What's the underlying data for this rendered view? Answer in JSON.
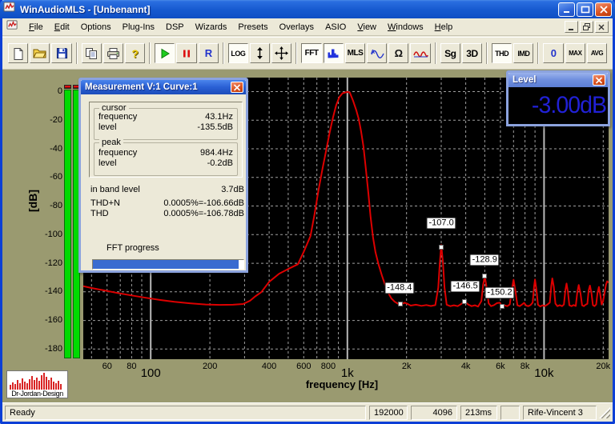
{
  "window": {
    "title": "WinAudioMLS - [Unbenannt]"
  },
  "menu": {
    "items": [
      {
        "label": "File",
        "u": 0
      },
      {
        "label": "Edit",
        "u": 0
      },
      {
        "label": "Options",
        "u": -1
      },
      {
        "label": "Plug-Ins",
        "u": -1
      },
      {
        "label": "DSP",
        "u": -1
      },
      {
        "label": "Wizards",
        "u": -1
      },
      {
        "label": "Presets",
        "u": -1
      },
      {
        "label": "Overlays",
        "u": -1
      },
      {
        "label": "ASIO",
        "u": -1
      },
      {
        "label": "View",
        "u": 0
      },
      {
        "label": "Windows",
        "u": 0
      },
      {
        "label": "Help",
        "u": 0
      }
    ]
  },
  "toolbar": {
    "groups": [
      [
        {
          "name": "new-document",
          "icon": "new-document"
        },
        {
          "name": "open-file",
          "icon": "open-folder"
        },
        {
          "name": "save-file",
          "icon": "save-floppy"
        }
      ],
      [
        {
          "name": "copy",
          "icon": "copy-pages"
        },
        {
          "name": "print",
          "icon": "printer"
        },
        {
          "name": "help",
          "icon": "help-question"
        }
      ],
      [
        {
          "name": "play",
          "icon": "play-triangle",
          "pressed": true
        },
        {
          "name": "pause",
          "icon": "pause-bars"
        },
        {
          "name": "record",
          "label": "R",
          "color": "#2233cc",
          "size": 13
        }
      ],
      [
        {
          "name": "log-scale",
          "label": "LOG",
          "pressed": true,
          "size": 9
        },
        {
          "name": "vertical-scale",
          "icon": "v-arrow"
        },
        {
          "name": "pan",
          "icon": "move-cross"
        }
      ],
      [
        {
          "name": "fft-mode",
          "label": "FFT",
          "pressed": true,
          "size": 10
        },
        {
          "name": "spectrum-display",
          "icon": "spectrum-bars",
          "pressed": true
        },
        {
          "name": "mls-mode",
          "label": "MLS",
          "size": 10
        },
        {
          "name": "sine-signal",
          "icon": "sine-wave"
        },
        {
          "name": "impedance",
          "icon": "omega"
        },
        {
          "name": "overlay-curves",
          "icon": "red-wave"
        }
      ],
      [
        {
          "name": "signal-generator",
          "label": "Sg",
          "size": 12
        },
        {
          "name": "3d-view",
          "label": "3D",
          "size": 12
        }
      ],
      [
        {
          "name": "thd-mode",
          "label": "THD",
          "pressed": true,
          "size": 9
        },
        {
          "name": "imd-mode",
          "label": "IMD",
          "size": 9
        }
      ],
      [
        {
          "name": "reset",
          "label": "0",
          "color": "#2233cc",
          "size": 13
        },
        {
          "name": "max-hold",
          "label": "MAX",
          "size": 8
        },
        {
          "name": "average",
          "label": "AVG",
          "size": 8
        }
      ]
    ]
  },
  "chart_data": {
    "type": "line",
    "xlabel": "frequency [Hz]",
    "ylabel": "[dB]",
    "x_scale": "log",
    "xlim": [
      45.4,
      21300
    ],
    "ylim": [
      -180,
      0
    ],
    "grid": "on",
    "y_ticks": [
      "0",
      "-20",
      "-40",
      "-60",
      "-80",
      "-100",
      "-120",
      "-140",
      "-160",
      "-180"
    ],
    "y_tick_values": [
      0,
      -20,
      -40,
      -60,
      -80,
      -100,
      -120,
      -140,
      -160,
      -180
    ],
    "x_ticks_minor": [
      {
        "f": 60,
        "t": "60"
      },
      {
        "f": 80,
        "t": "80"
      },
      {
        "f": 200,
        "t": "200"
      },
      {
        "f": 400,
        "t": "400"
      },
      {
        "f": 600,
        "t": "600"
      },
      {
        "f": 800,
        "t": "800"
      },
      {
        "f": 2000,
        "t": "2k"
      },
      {
        "f": 4000,
        "t": "4k"
      },
      {
        "f": 6000,
        "t": "6k"
      },
      {
        "f": 8000,
        "t": "8k"
      },
      {
        "f": 20000,
        "t": "20k"
      }
    ],
    "x_ticks_major": [
      {
        "f": 100,
        "t": "100"
      },
      {
        "f": 1000,
        "t": "1k"
      },
      {
        "f": 10000,
        "t": "10k"
      }
    ],
    "series": [
      {
        "name": "spectrum",
        "color": "#dd0000",
        "points": [
          [
            45.4,
            -136
          ],
          [
            50,
            -137.3
          ],
          [
            58,
            -139
          ],
          [
            68,
            -140.8
          ],
          [
            80,
            -142.5
          ],
          [
            95,
            -144.2
          ],
          [
            112,
            -145.7
          ],
          [
            132,
            -147
          ],
          [
            158,
            -148
          ],
          [
            190,
            -148.8
          ],
          [
            225,
            -149.1
          ],
          [
            262,
            -149
          ],
          [
            295,
            -148.5
          ],
          [
            320,
            -146.2
          ],
          [
            340,
            -143.2
          ],
          [
            365,
            -140.2
          ],
          [
            400,
            -133
          ],
          [
            450,
            -127.3
          ],
          [
            500,
            -124
          ],
          [
            560,
            -120.7
          ],
          [
            600,
            -112
          ],
          [
            649,
            -101
          ],
          [
            680,
            -86
          ],
          [
            713,
            -69
          ],
          [
            747,
            -54
          ],
          [
            783,
            -40
          ],
          [
            813,
            -28.5
          ],
          [
            844,
            -18.4
          ],
          [
            877,
            -9.5
          ],
          [
            910,
            -3.9
          ],
          [
            945,
            -1.1
          ],
          [
            1000,
            -0.2
          ],
          [
            1029,
            -0.6
          ],
          [
            1068,
            -6.2
          ],
          [
            1109,
            -12.8
          ],
          [
            1141,
            -19
          ],
          [
            1173,
            -27.4
          ],
          [
            1207,
            -38.5
          ],
          [
            1241,
            -53.6
          ],
          [
            1277,
            -70.4
          ],
          [
            1313,
            -87.7
          ],
          [
            1351,
            -102.2
          ],
          [
            1390,
            -112.3
          ],
          [
            1443,
            -121.2
          ],
          [
            1498,
            -128.5
          ],
          [
            1555,
            -135.2
          ],
          [
            1615,
            -140.8
          ],
          [
            1677,
            -144.7
          ],
          [
            1741,
            -146.9
          ],
          [
            1825,
            -148.6
          ],
          [
            1900,
            -148.4
          ],
          [
            1955,
            -147.6
          ],
          [
            2020,
            -148.3
          ],
          [
            2100,
            -149.6
          ],
          [
            2230,
            -149
          ],
          [
            2380,
            -149.8
          ],
          [
            2520,
            -149.2
          ],
          [
            2660,
            -149.9
          ],
          [
            2800,
            -149.3
          ],
          [
            2900,
            -137
          ],
          [
            2950,
            -120
          ],
          [
            3000,
            -107.2
          ],
          [
            3060,
            -119
          ],
          [
            3120,
            -137
          ],
          [
            3200,
            -149
          ],
          [
            3340,
            -150
          ],
          [
            3480,
            -149.4
          ],
          [
            3640,
            -150
          ],
          [
            3800,
            -148.4
          ],
          [
            3950,
            -146.8
          ],
          [
            4120,
            -148.9
          ],
          [
            4280,
            -150
          ],
          [
            4450,
            -149.4
          ],
          [
            4620,
            -150.3
          ],
          [
            4800,
            -146.5
          ],
          [
            4900,
            -135
          ],
          [
            5000,
            -129
          ],
          [
            5110,
            -137.5
          ],
          [
            5230,
            -148
          ],
          [
            5380,
            -150
          ],
          [
            5560,
            -149.3
          ],
          [
            5760,
            -147.9
          ],
          [
            5960,
            -147.6
          ],
          [
            6120,
            -150.2
          ],
          [
            6300,
            -149.4
          ],
          [
            6500,
            -150
          ],
          [
            6700,
            -148.8
          ],
          [
            6850,
            -139
          ],
          [
            7000,
            -131.5
          ],
          [
            7160,
            -139.5
          ],
          [
            7320,
            -149.4
          ],
          [
            7520,
            -150
          ],
          [
            7720,
            -148.9
          ],
          [
            7920,
            -147.7
          ],
          [
            8120,
            -149.6
          ],
          [
            8320,
            -150
          ],
          [
            8540,
            -149.3
          ],
          [
            8760,
            -147.5
          ],
          [
            8900,
            -136.5
          ],
          [
            9000,
            -131.4
          ],
          [
            9160,
            -139
          ],
          [
            9320,
            -149
          ],
          [
            9560,
            -150.2
          ],
          [
            9820,
            -149.4
          ],
          [
            10100,
            -150
          ],
          [
            10420,
            -148.8
          ],
          [
            10700,
            -147.5
          ],
          [
            10880,
            -136
          ],
          [
            11020,
            -130.6
          ],
          [
            11220,
            -136.5
          ],
          [
            11430,
            -148.2
          ],
          [
            11700,
            -150
          ],
          [
            12020,
            -149.3
          ],
          [
            12340,
            -150
          ],
          [
            12620,
            -148.8
          ],
          [
            12850,
            -138.5
          ],
          [
            13020,
            -134.2
          ],
          [
            13230,
            -140
          ],
          [
            13460,
            -149.4
          ],
          [
            13800,
            -150
          ],
          [
            14140,
            -149.2
          ],
          [
            14500,
            -149.9
          ],
          [
            14760,
            -140.5
          ],
          [
            15020,
            -135.2
          ],
          [
            15320,
            -141
          ],
          [
            15620,
            -149.4
          ],
          [
            15940,
            -150
          ],
          [
            16280,
            -149
          ],
          [
            16620,
            -148.3
          ],
          [
            16870,
            -139
          ],
          [
            17120,
            -135.6
          ],
          [
            17420,
            -141
          ],
          [
            17730,
            -149.3
          ],
          [
            18060,
            -150
          ],
          [
            18420,
            -148.8
          ],
          [
            18720,
            -140.5
          ],
          [
            19020,
            -136.6
          ],
          [
            19330,
            -142
          ],
          [
            19640,
            -148.8
          ],
          [
            19950,
            -146.8
          ],
          [
            20300,
            -141
          ],
          [
            20650,
            -135
          ],
          [
            20950,
            -132.6
          ],
          [
            21300,
            -133.5
          ]
        ]
      }
    ],
    "peak_labels": [
      {
        "text": "-107.0",
        "f": 3005,
        "db": -92,
        "mf": 3000,
        "mdb": -109.5
      },
      {
        "text": "-148.4",
        "f": 1840,
        "db": -137.5,
        "mf": 1855,
        "mdb": -148.8
      },
      {
        "text": "-146.5",
        "f": 3980,
        "db": -136.3,
        "mf": 3950,
        "mdb": -147.2
      },
      {
        "text": "-128.9",
        "f": 4990,
        "db": -118,
        "mf": 5000,
        "mdb": -129.4
      },
      {
        "text": "-150.2",
        "f": 5950,
        "db": -140.8,
        "mf": 6100,
        "mdb": -150.6
      }
    ]
  },
  "measurement": {
    "title": "Measurement V:1 Curve:1",
    "cursor": {
      "label": "cursor",
      "rows": [
        {
          "label": "frequency",
          "value": "43.1Hz"
        },
        {
          "label": "level",
          "value": "-135.5dB"
        }
      ]
    },
    "peak": {
      "label": "peak",
      "rows": [
        {
          "label": "frequency",
          "value": "984.4Hz"
        },
        {
          "label": "level",
          "value": "-0.2dB"
        }
      ]
    },
    "info": [
      {
        "label": "in band level",
        "value": "3.7dB"
      },
      {
        "label": "THD+N",
        "value": "0.0005%=-106.66dB"
      },
      {
        "label": "THD",
        "value": "0.0005%=-106.78dB"
      }
    ],
    "progress_label": "FFT progress",
    "progress_percent": 97
  },
  "level": {
    "title": "Level",
    "value": "-3.00dB",
    "color": "#2121d6"
  },
  "statusbar": {
    "ready": "Ready",
    "panels": [
      "192000",
      "4096",
      "213ms",
      "",
      "Rife-Vincent 3"
    ]
  },
  "logo": {
    "text": "Dr-Jordan-Design"
  },
  "colors": {
    "curve": "#dd0000",
    "plot_bg": "#000000",
    "client_bg": "#9a9a70",
    "meter_green": "#00da00",
    "meter_red": "#e01010",
    "accent_blue": "#0c3fd6"
  }
}
